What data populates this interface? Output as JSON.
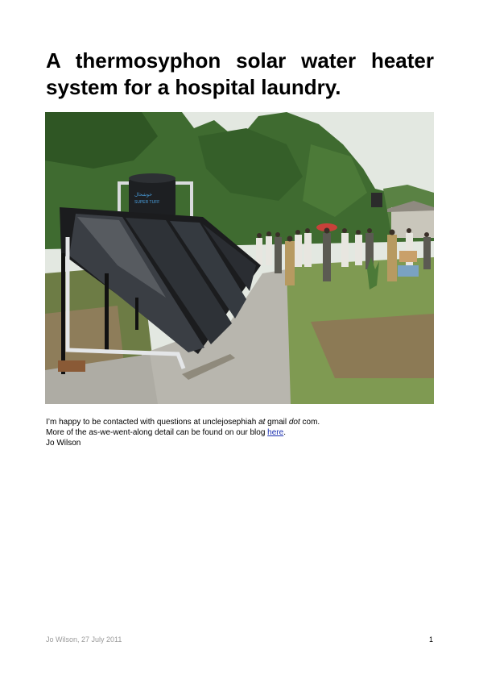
{
  "title": "A thermosyphon solar water heater system for a hospital laundry.",
  "photo": {
    "tank_label": "SUPER TUFF"
  },
  "body": {
    "line1_prefix": "I’m happy to be contacted with questions at unclejosephiah ",
    "line1_at": "at",
    "line1_middle": " gmail ",
    "line1_dot": "dot",
    "line1_suffix": " com.",
    "line2_prefix": "More of the as-we-went-along detail can be found on our blog ",
    "line2_link": "here",
    "line2_suffix": ".",
    "line3": "Jo Wilson"
  },
  "footer": {
    "left": "Jo Wilson, 27 July 2011",
    "page_number": "1"
  },
  "colors": {
    "link": "#1a2fb0",
    "footer_text": "#9a9a9a"
  }
}
